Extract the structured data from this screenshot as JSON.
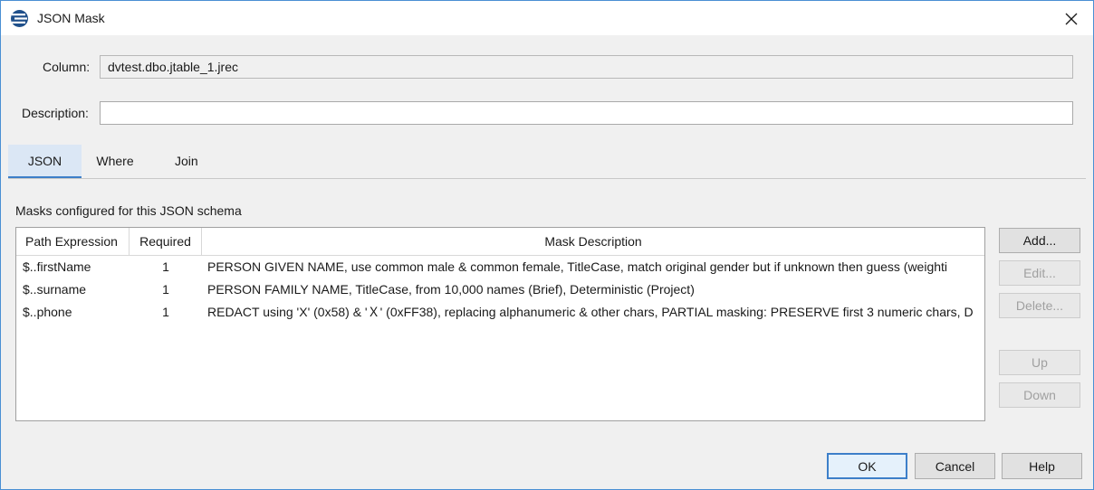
{
  "window": {
    "title": "JSON Mask",
    "accent_color": "#3d7fc9"
  },
  "form": {
    "column_label": "Column:",
    "column_value": "dvtest.dbo.jtable_1.jrec",
    "description_label": "Description:",
    "description_value": ""
  },
  "tabs": [
    {
      "label": "JSON",
      "active": true
    },
    {
      "label": "Where",
      "active": false
    },
    {
      "label": "Join",
      "active": false
    }
  ],
  "masks": {
    "section_label": "Masks configured for this JSON schema",
    "columns": [
      "Path Expression",
      "Required",
      "Mask Description"
    ],
    "rows": [
      {
        "path": "$..firstName",
        "required": "1",
        "description": "PERSON GIVEN NAME, use common male & common female, TitleCase, match original gender but if unknown then guess (weighti"
      },
      {
        "path": "$..surname",
        "required": "1",
        "description": "PERSON FAMILY NAME, TitleCase, from 10,000 names (Brief), Deterministic (Project)"
      },
      {
        "path": "$..phone",
        "required": "1",
        "description": "REDACT using 'X' (0x58) & 'Ｘ' (0xFF38), replacing alphanumeric & other chars, PARTIAL masking: PRESERVE first 3 numeric chars, D"
      }
    ]
  },
  "side_buttons": {
    "add": "Add...",
    "edit": "Edit...",
    "delete": "Delete...",
    "up": "Up",
    "down": "Down"
  },
  "dialog_buttons": {
    "ok": "OK",
    "cancel": "Cancel",
    "help": "Help"
  }
}
